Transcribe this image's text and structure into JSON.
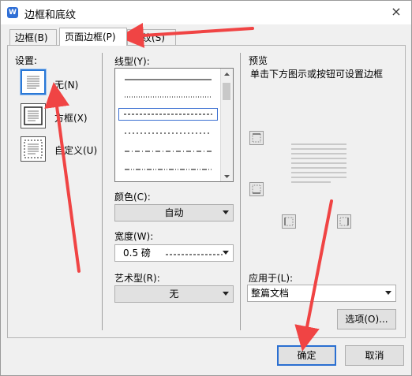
{
  "window": {
    "title": "边框和底纹",
    "close_glyph": "×",
    "app_icon": "wps-writer-icon"
  },
  "tabs": [
    {
      "label": "边框(B)"
    },
    {
      "label": "页面边框(P)"
    },
    {
      "label": "底纹(S)"
    }
  ],
  "settings": {
    "heading": "设置:",
    "options": [
      {
        "label": "无(N)",
        "selected": true
      },
      {
        "label": "方框(X)",
        "selected": false
      },
      {
        "label": "自定义(U)",
        "selected": false
      }
    ]
  },
  "style": {
    "line_label": "线型(Y):",
    "line_styles": [
      "solid",
      "dotted",
      "dashed",
      "small-dashed",
      "dash-dot",
      "dash-dot-dot"
    ],
    "selected_line_index": 2,
    "color_label": "颜色(C):",
    "color_value": "自动",
    "width_label": "宽度(W):",
    "width_value": "0.5 磅",
    "art_label": "艺术型(R):",
    "art_value": "无"
  },
  "preview": {
    "heading": "预览",
    "hint": "单击下方图示或按钮可设置边框",
    "apply_label": "应用于(L):",
    "apply_value": "整篇文档",
    "options_button": "选项(O)..."
  },
  "footer": {
    "ok_button": "确定",
    "cancel_button": "取消"
  },
  "colors": {
    "accent": "#2a6fd1",
    "annotation_arrow": "#f04444"
  }
}
